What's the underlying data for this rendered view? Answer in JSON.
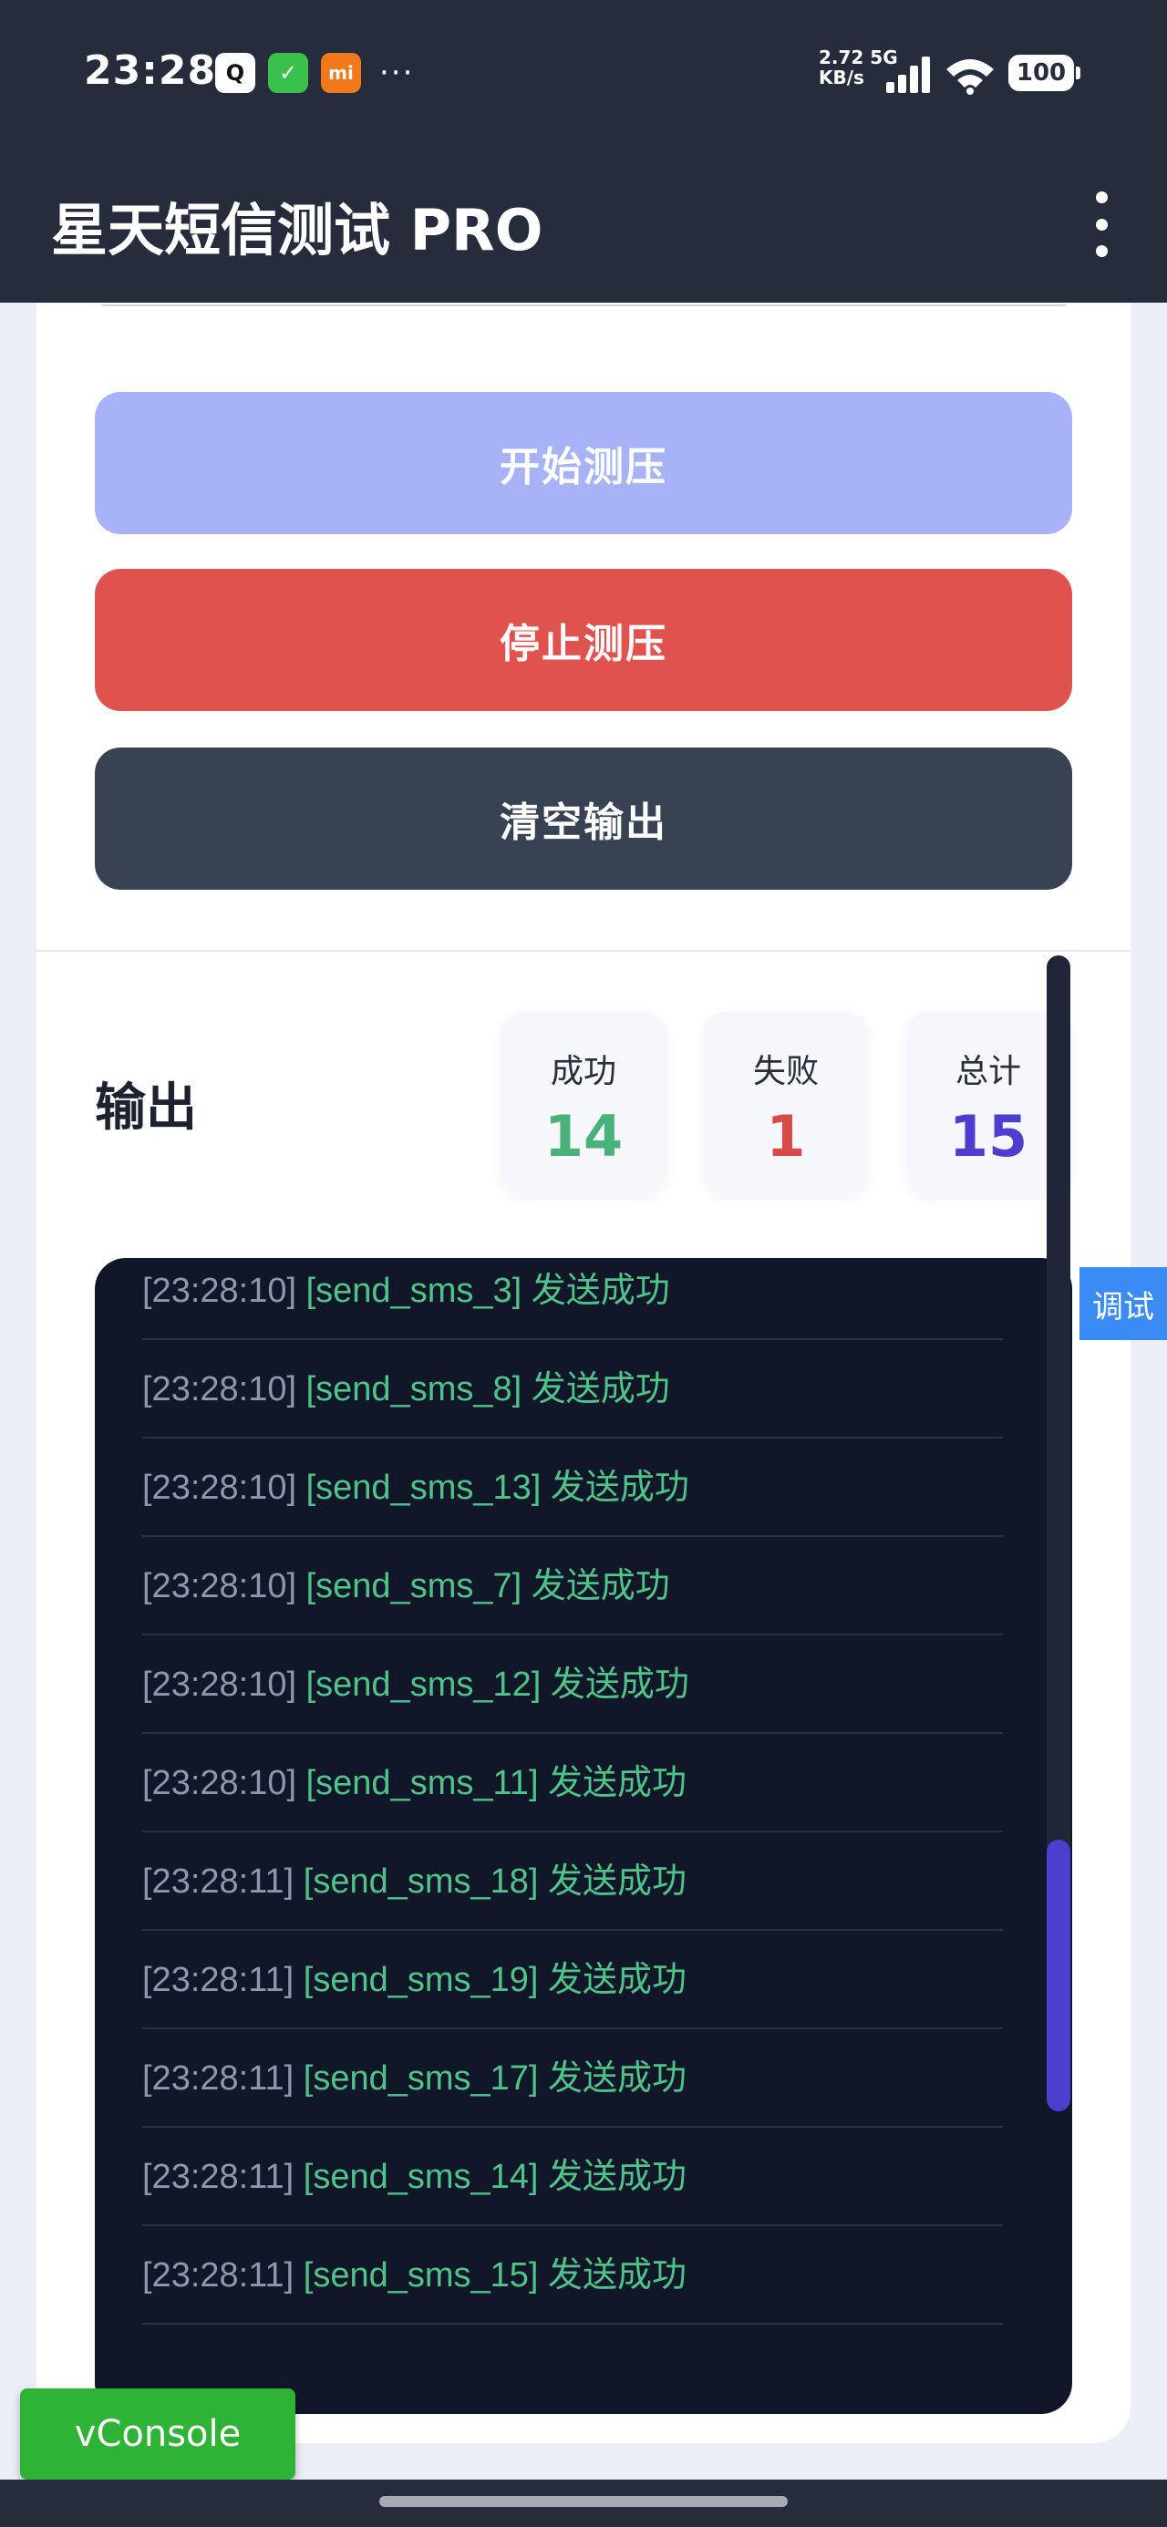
{
  "status_bar": {
    "time": "23:28",
    "app_icons": [
      {
        "name": "qq-icon",
        "glyph": "Q"
      },
      {
        "name": "shield-icon",
        "glyph": "✓"
      },
      {
        "name": "mi-icon",
        "glyph": "mi"
      }
    ],
    "more": "···",
    "net_speed_value": "2.72 5G",
    "net_speed_unit": "KB/s",
    "battery": "100"
  },
  "app_bar": {
    "title": "星天短信测试 PRO"
  },
  "actions": {
    "start_label": "开始测压",
    "stop_label": "停止测压",
    "clear_label": "清空输出"
  },
  "output": {
    "title": "输出",
    "stats": {
      "success_label": "成功",
      "success_value": "14",
      "fail_label": "失败",
      "fail_value": "1",
      "total_label": "总计",
      "total_value": "15"
    },
    "logs": [
      {
        "time": "[23:28:10]",
        "msg": "[send_sms_3] 发送成功"
      },
      {
        "time": "[23:28:10]",
        "msg": "[send_sms_8] 发送成功"
      },
      {
        "time": "[23:28:10]",
        "msg": "[send_sms_13] 发送成功"
      },
      {
        "time": "[23:28:10]",
        "msg": "[send_sms_7] 发送成功"
      },
      {
        "time": "[23:28:10]",
        "msg": "[send_sms_12] 发送成功"
      },
      {
        "time": "[23:28:10]",
        "msg": "[send_sms_11] 发送成功"
      },
      {
        "time": "[23:28:11]",
        "msg": "[send_sms_18] 发送成功"
      },
      {
        "time": "[23:28:11]",
        "msg": "[send_sms_19] 发送成功"
      },
      {
        "time": "[23:28:11]",
        "msg": "[send_sms_17] 发送成功"
      },
      {
        "time": "[23:28:11]",
        "msg": "[send_sms_14] 发送成功"
      },
      {
        "time": "[23:28:11]",
        "msg": "[send_sms_15] 发送成功"
      }
    ]
  },
  "debug_tab": "调试",
  "vconsole": "vConsole",
  "colors": {
    "success": "#49b27a",
    "fail": "#d64b47",
    "total": "#4c3fd0",
    "start_button": "#a7b3f6",
    "stop_button": "#e0524e",
    "clear_button": "#394253"
  }
}
